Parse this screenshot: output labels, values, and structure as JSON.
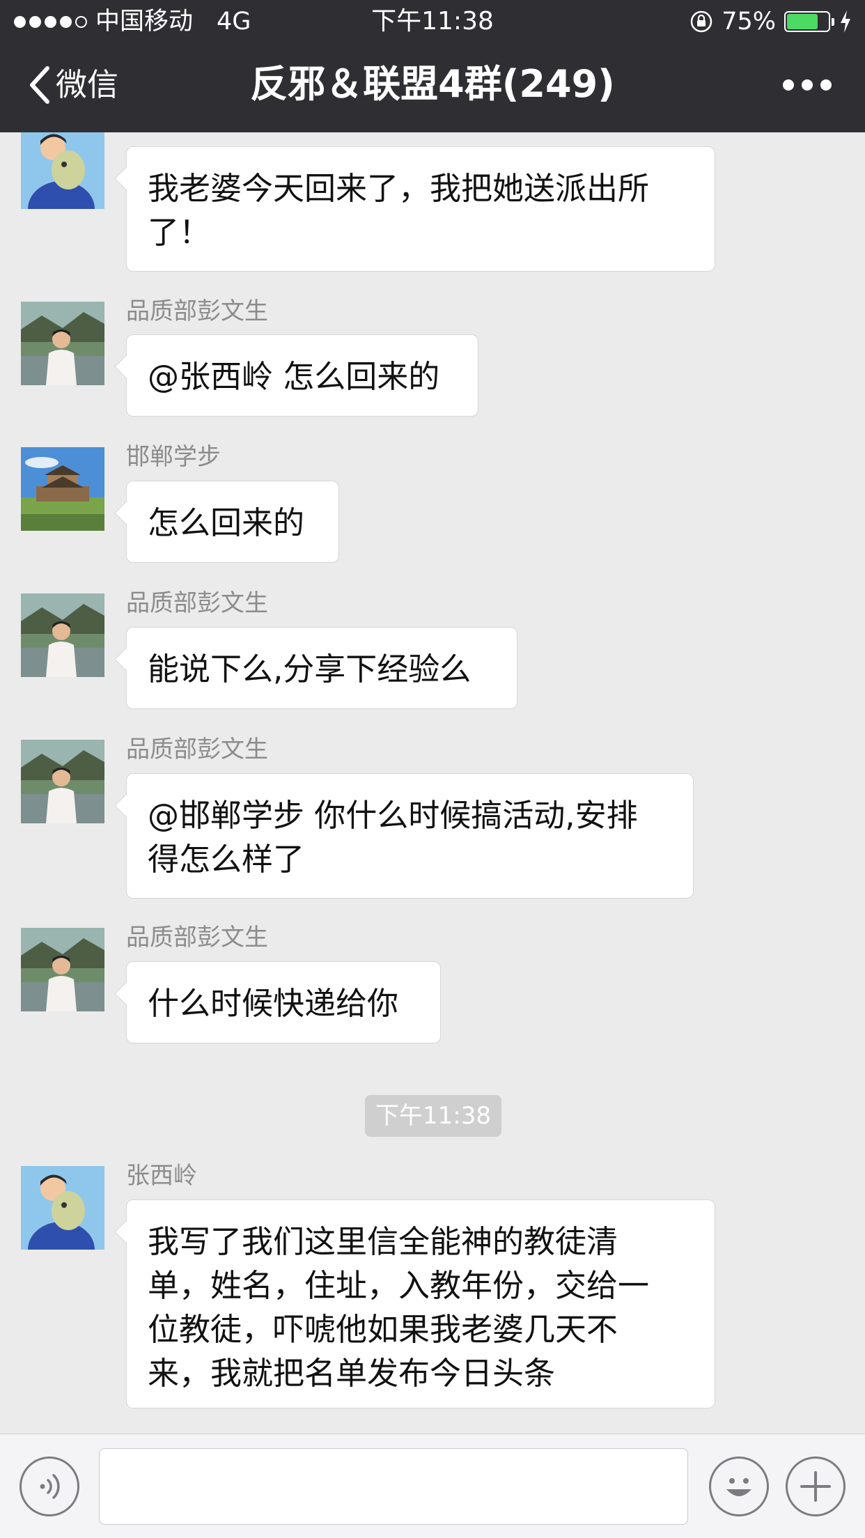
{
  "status_bar": {
    "carrier": "中国移动",
    "network": "4G",
    "time": "下午11:38",
    "battery_percent": "75%",
    "battery_level": 0.75,
    "signal_bars_filled": 4,
    "signal_bars_total": 5,
    "icons": [
      "rotation-lock-icon",
      "charging-bolt-icon"
    ]
  },
  "nav": {
    "back_label": "微信",
    "title": "反邪＆联盟4群(249)",
    "more_icon": "ellipsis-icon"
  },
  "messages": [
    {
      "sender": "",
      "avatar": "avatar-child-with-dog",
      "lines": [
        "我老婆今天回来了，我把她送派出所",
        "了！"
      ]
    },
    {
      "sender": "品质部彭文生",
      "avatar": "avatar-man-riverside",
      "lines": [
        "@张西岭 怎么回来的"
      ]
    },
    {
      "sender": "邯郸学步",
      "avatar": "avatar-tower-landscape",
      "lines": [
        "怎么回来的"
      ]
    },
    {
      "sender": "品质部彭文生",
      "avatar": "avatar-man-riverside",
      "lines": [
        "能说下么,分享下经验么"
      ]
    },
    {
      "sender": "品质部彭文生",
      "avatar": "avatar-man-riverside",
      "lines": [
        "@邯郸学步 你什么时候搞活动,安排",
        "得怎么样了"
      ]
    },
    {
      "sender": "品质部彭文生",
      "avatar": "avatar-man-riverside",
      "lines": [
        "什么时候快递给你"
      ]
    },
    {
      "sender": "张西岭",
      "avatar": "avatar-child-with-dog",
      "lines": [
        "我写了我们这里信全能神的教徒清",
        "单，姓名，住址，入教年份，交给一",
        "位教徒，吓唬他如果我老婆几天不",
        "来，我就把名单发布今日头条"
      ]
    }
  ],
  "timestamp_divider": "下午11:38",
  "input_bar": {
    "value": "",
    "icons": [
      "voice-icon",
      "emoji-icon",
      "plus-icon"
    ]
  },
  "colors": {
    "header_bg": "#2f2f33",
    "chat_bg": "#ebebeb",
    "bubble_bg": "#ffffff",
    "battery_green": "#4cd964"
  }
}
